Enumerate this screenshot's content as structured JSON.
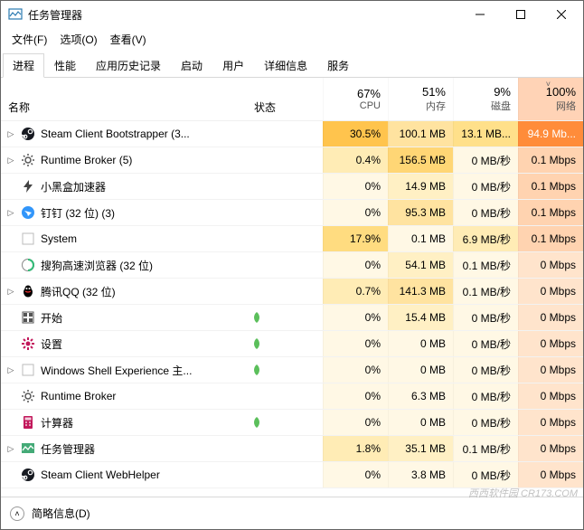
{
  "window": {
    "title": "任务管理器",
    "min_icon": "min",
    "max_icon": "max",
    "close_icon": "close"
  },
  "menubar": [
    "文件(F)",
    "选项(O)",
    "查看(V)"
  ],
  "tabs": [
    "进程",
    "性能",
    "应用历史记录",
    "启动",
    "用户",
    "详细信息",
    "服务"
  ],
  "active_tab": 0,
  "columns": {
    "name": "名称",
    "status": "状态",
    "cpu": {
      "pct": "67%",
      "label": "CPU"
    },
    "mem": {
      "pct": "51%",
      "label": "内存"
    },
    "disk": {
      "pct": "9%",
      "label": "磁盘"
    },
    "net": {
      "pct": "100%",
      "label": "网络"
    },
    "sort_indicator": "˅"
  },
  "rows": [
    {
      "expand": true,
      "icon": "steam",
      "name": "Steam Client Bootstrapper (3...",
      "leaf": false,
      "cpu": "30.5%",
      "cpu_c": 3,
      "mem": "100.1 MB",
      "mem_c": 2,
      "disk": "13.1 MB...",
      "disk_c": 2,
      "net": "94.9 Mb...",
      "net_c": -1
    },
    {
      "expand": true,
      "icon": "gear",
      "name": "Runtime Broker (5)",
      "leaf": false,
      "cpu": "0.4%",
      "cpu_c": 1,
      "mem": "156.5 MB",
      "mem_c": 3,
      "disk": "0 MB/秒",
      "disk_c": 0,
      "net": "0.1 Mbps",
      "net_c": 1
    },
    {
      "expand": false,
      "icon": "bolt",
      "name": "小黑盒加速器",
      "leaf": false,
      "cpu": "0%",
      "cpu_c": 0,
      "mem": "14.9 MB",
      "mem_c": 1,
      "disk": "0 MB/秒",
      "disk_c": 0,
      "net": "0.1 Mbps",
      "net_c": 1
    },
    {
      "expand": true,
      "icon": "ding",
      "name": "钉钉 (32 位) (3)",
      "leaf": false,
      "cpu": "0%",
      "cpu_c": 0,
      "mem": "95.3 MB",
      "mem_c": 2,
      "disk": "0 MB/秒",
      "disk_c": 0,
      "net": "0.1 Mbps",
      "net_c": 1
    },
    {
      "expand": false,
      "icon": "blank",
      "name": "System",
      "leaf": false,
      "cpu": "17.9%",
      "cpu_c": 2,
      "mem": "0.1 MB",
      "mem_c": 0,
      "disk": "6.9 MB/秒",
      "disk_c": 1,
      "net": "0.1 Mbps",
      "net_c": 1
    },
    {
      "expand": false,
      "icon": "sogou",
      "name": "搜狗高速浏览器 (32 位)",
      "leaf": false,
      "cpu": "0%",
      "cpu_c": 0,
      "mem": "54.1 MB",
      "mem_c": 1,
      "disk": "0.1 MB/秒",
      "disk_c": 0,
      "net": "0 Mbps",
      "net_c": 0
    },
    {
      "expand": true,
      "icon": "qq",
      "name": "腾讯QQ (32 位)",
      "leaf": false,
      "cpu": "0.7%",
      "cpu_c": 1,
      "mem": "141.3 MB",
      "mem_c": 2,
      "disk": "0.1 MB/秒",
      "disk_c": 0,
      "net": "0 Mbps",
      "net_c": 0
    },
    {
      "expand": false,
      "icon": "start",
      "name": "开始",
      "leaf": true,
      "cpu": "0%",
      "cpu_c": 0,
      "mem": "15.4 MB",
      "mem_c": 1,
      "disk": "0 MB/秒",
      "disk_c": 0,
      "net": "0 Mbps",
      "net_c": 0
    },
    {
      "expand": false,
      "icon": "settings",
      "name": "设置",
      "leaf": true,
      "cpu": "0%",
      "cpu_c": 0,
      "mem": "0 MB",
      "mem_c": 0,
      "disk": "0 MB/秒",
      "disk_c": 0,
      "net": "0 Mbps",
      "net_c": 0
    },
    {
      "expand": true,
      "icon": "blank",
      "name": "Windows Shell Experience 主...",
      "leaf": true,
      "cpu": "0%",
      "cpu_c": 0,
      "mem": "0 MB",
      "mem_c": 0,
      "disk": "0 MB/秒",
      "disk_c": 0,
      "net": "0 Mbps",
      "net_c": 0
    },
    {
      "expand": false,
      "icon": "gear",
      "name": "Runtime Broker",
      "leaf": false,
      "cpu": "0%",
      "cpu_c": 0,
      "mem": "6.3 MB",
      "mem_c": 0,
      "disk": "0 MB/秒",
      "disk_c": 0,
      "net": "0 Mbps",
      "net_c": 0
    },
    {
      "expand": false,
      "icon": "calc",
      "name": "计算器",
      "leaf": true,
      "cpu": "0%",
      "cpu_c": 0,
      "mem": "0 MB",
      "mem_c": 0,
      "disk": "0 MB/秒",
      "disk_c": 0,
      "net": "0 Mbps",
      "net_c": 0
    },
    {
      "expand": true,
      "icon": "taskmgr",
      "name": "任务管理器",
      "leaf": false,
      "cpu": "1.8%",
      "cpu_c": 1,
      "mem": "35.1 MB",
      "mem_c": 1,
      "disk": "0.1 MB/秒",
      "disk_c": 0,
      "net": "0 Mbps",
      "net_c": 0
    },
    {
      "expand": false,
      "icon": "steam",
      "name": "Steam Client WebHelper",
      "leaf": false,
      "cpu": "0%",
      "cpu_c": 0,
      "mem": "3.8 MB",
      "mem_c": 0,
      "disk": "0 MB/秒",
      "disk_c": 0,
      "net": "0 Mbps",
      "net_c": 0
    }
  ],
  "footer": {
    "label": "简略信息(D)"
  },
  "watermark": "西西软件园 CR173.COM"
}
